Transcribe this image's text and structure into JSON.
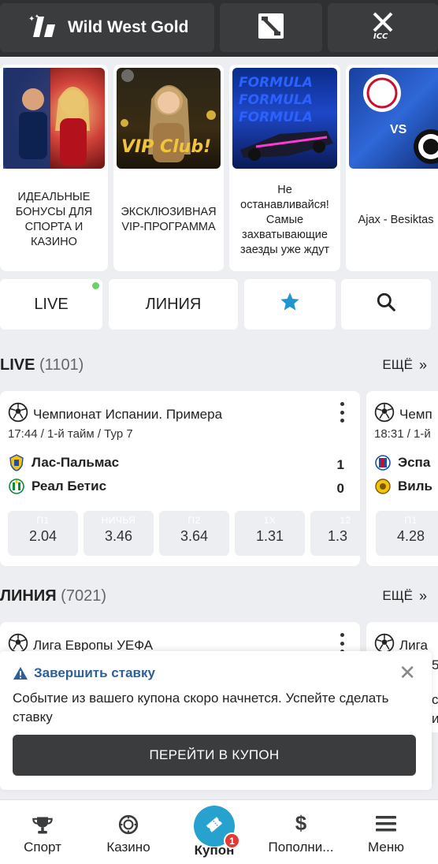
{
  "topbar": {
    "game_title": "Wild West Gold",
    "items": [
      {
        "icon": "wild-west-logo-icon"
      },
      {
        "icon": "dota2-icon"
      },
      {
        "icon": "icc-cricket-icon"
      }
    ]
  },
  "promos": [
    {
      "text": "ИДЕАЛЬНЫЕ БОНУСЫ ДЛЯ СПОРТА И КАЗИНО"
    },
    {
      "text": "ЭКСКЛЮЗИВНАЯ VIP-ПРОГРАММА",
      "image_text": "VIP Club!"
    },
    {
      "text": "Не останавливайся! Самые захватывающие заезды уже ждут",
      "image_text": "FORMULA"
    },
    {
      "text": "Ajax - Besiktas",
      "image_text": "VS"
    }
  ],
  "tabs": {
    "live": "LIVE",
    "line": "ЛИНИЯ",
    "favorites_icon": "star-icon",
    "search_icon": "search-icon"
  },
  "live_section": {
    "title": "LIVE",
    "count": "(1101)",
    "more": "ЕЩЁ"
  },
  "live_events": [
    {
      "league": "Чемпионат Испании. Примера",
      "meta": "17:44 / 1-й тайм / Тур 7",
      "team1": "Лас-Пальмас",
      "team2": "Реал Бетис",
      "score1": "1",
      "score2": "0",
      "odds": [
        {
          "label": "П1",
          "value": "2.04"
        },
        {
          "label": "НИЧЬЯ",
          "value": "3.46"
        },
        {
          "label": "П2",
          "value": "3.64"
        },
        {
          "label": "1Х",
          "value": "1.31"
        },
        {
          "label": "12",
          "value": "1.3"
        }
      ]
    },
    {
      "league": "Чемп",
      "meta": "18:31 / 1-й",
      "team1": "Эспа",
      "team2": "Виль",
      "odds": [
        {
          "label": "П1",
          "value": "4.28"
        }
      ]
    }
  ],
  "line_section": {
    "title": "ЛИНИЯ",
    "count": "(7021)",
    "more": "ЕЩЁ"
  },
  "line_events": [
    {
      "league": "Лига Европы УЕФА"
    },
    {
      "league": "Лига"
    }
  ],
  "notification": {
    "title": "Завершить ставку",
    "body": "Событие из вашего купона скоро начнется. Успейте сделать ставку",
    "cta": "ПЕРЕЙТИ В КУПОН",
    "peek_chars": [
      "5",
      "с",
      "и"
    ]
  },
  "bottom_nav": [
    {
      "label": "Спорт",
      "icon": "trophy-icon"
    },
    {
      "label": "Казино",
      "icon": "casino-chip-icon"
    },
    {
      "label": "Купон",
      "icon": "ticket-icon",
      "badge": "1"
    },
    {
      "label": "Пополни...",
      "icon": "dollar-icon"
    },
    {
      "label": "Меню",
      "icon": "menu-icon"
    }
  ],
  "colors": {
    "accent": "#27a2cf",
    "badge": "#e53935",
    "live_dot": "#6fcf6a",
    "dark": "#2f3031"
  }
}
